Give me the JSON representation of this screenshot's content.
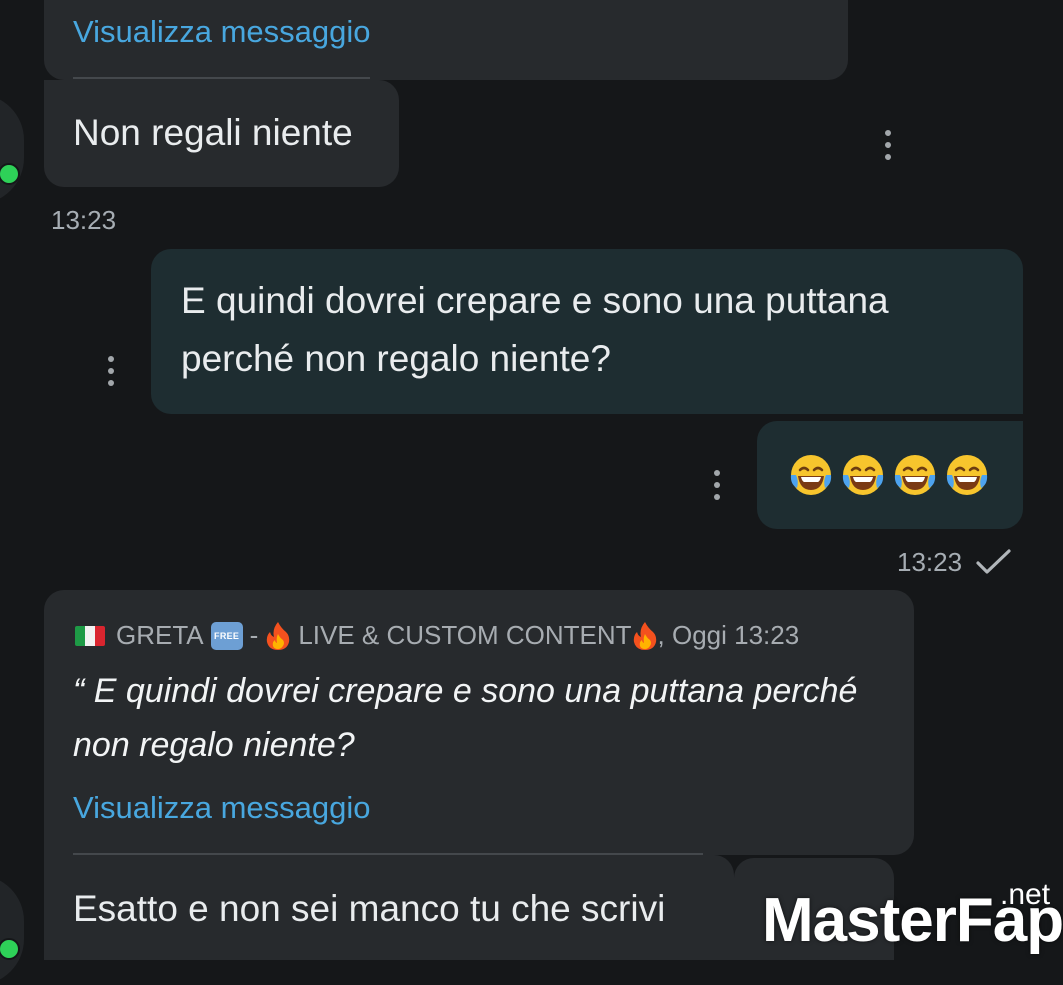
{
  "conversation": {
    "msg1": {
      "link_label": "Visualizza messaggio",
      "text": "Non regali niente",
      "time": "13:23"
    },
    "msg2": {
      "text": "E quindi dovrei crepare e sono una puttana perché non regalo niente?"
    },
    "msg3": {
      "emoji": "😂😂😂😂",
      "emoji_count": 4,
      "time": "13:23",
      "status_icon": "single-check-icon"
    },
    "msg4": {
      "reply_header": {
        "flag": "🇮🇹",
        "name": "GRETA",
        "badge": "FREE",
        "separator": "-",
        "channel": "LIVE & CUSTOM CONTENT",
        "suffix": ", Oggi 13:23"
      },
      "quote": "“ E quindi dovrei crepare e sono una puttana perché non regalo niente?",
      "link_label": "Visualizza messaggio",
      "text": "Esatto e non sei manco tu che scrivi"
    }
  },
  "watermark": {
    "brand_a": "Master",
    "brand_b": "Fap",
    "tld": ".net"
  },
  "colors": {
    "background": "#151719",
    "incoming_bubble": "#272a2d",
    "outgoing_bubble": "#1e2d31",
    "link": "#48a7df",
    "online": "#2ed158"
  }
}
